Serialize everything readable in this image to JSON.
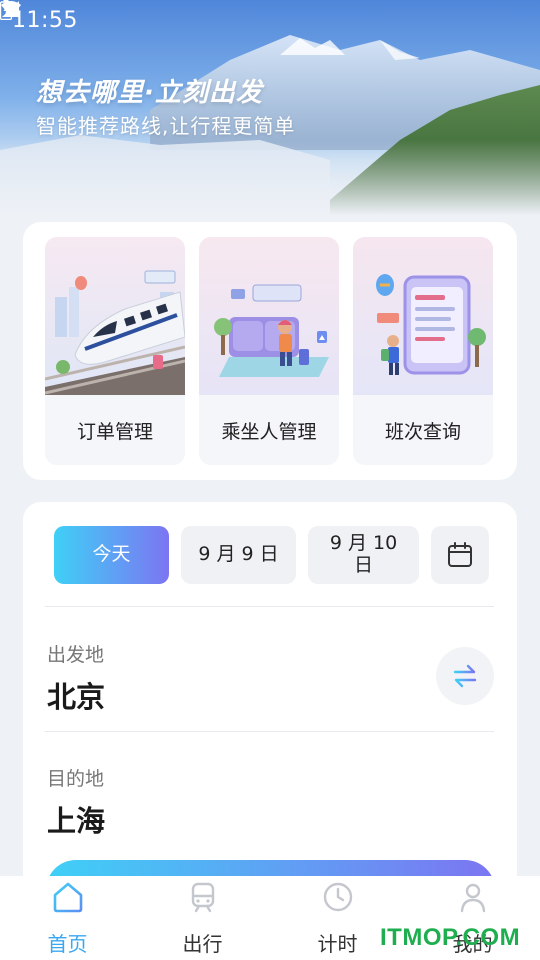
{
  "status_bar": {
    "time": "11:55",
    "icons": [
      "wifi-icon",
      "signal-icon",
      "battery-icon"
    ]
  },
  "hero": {
    "title": "想去哪里·立刻出发",
    "subtitle": "智能推荐路线,让行程更简单"
  },
  "features": [
    {
      "label": "订单管理",
      "icon": "train-illustration"
    },
    {
      "label": "乘坐人管理",
      "icon": "passenger-illustration"
    },
    {
      "label": "班次查询",
      "icon": "schedule-illustration"
    }
  ],
  "dates": {
    "today": "今天",
    "day1": "9 月 9 日",
    "day2": "9 月 10 日",
    "calendar_icon": "calendar-icon"
  },
  "departure": {
    "label": "出发地",
    "value": "北京"
  },
  "destination": {
    "label": "目的地",
    "value": "上海"
  },
  "nav": [
    {
      "label": "首页",
      "icon": "home-icon",
      "active": true
    },
    {
      "label": "出行",
      "icon": "train-icon",
      "active": false
    },
    {
      "label": "计时",
      "icon": "clock-icon",
      "active": false
    },
    {
      "label": "我的",
      "icon": "user-icon",
      "active": false
    }
  ],
  "watermark": "ITMOP.COM",
  "colors": {
    "accent_start": "#3fd0f6",
    "accent_end": "#7c75f2",
    "nav_active": "#3aa8f0",
    "watermark": "#1fae4f"
  }
}
